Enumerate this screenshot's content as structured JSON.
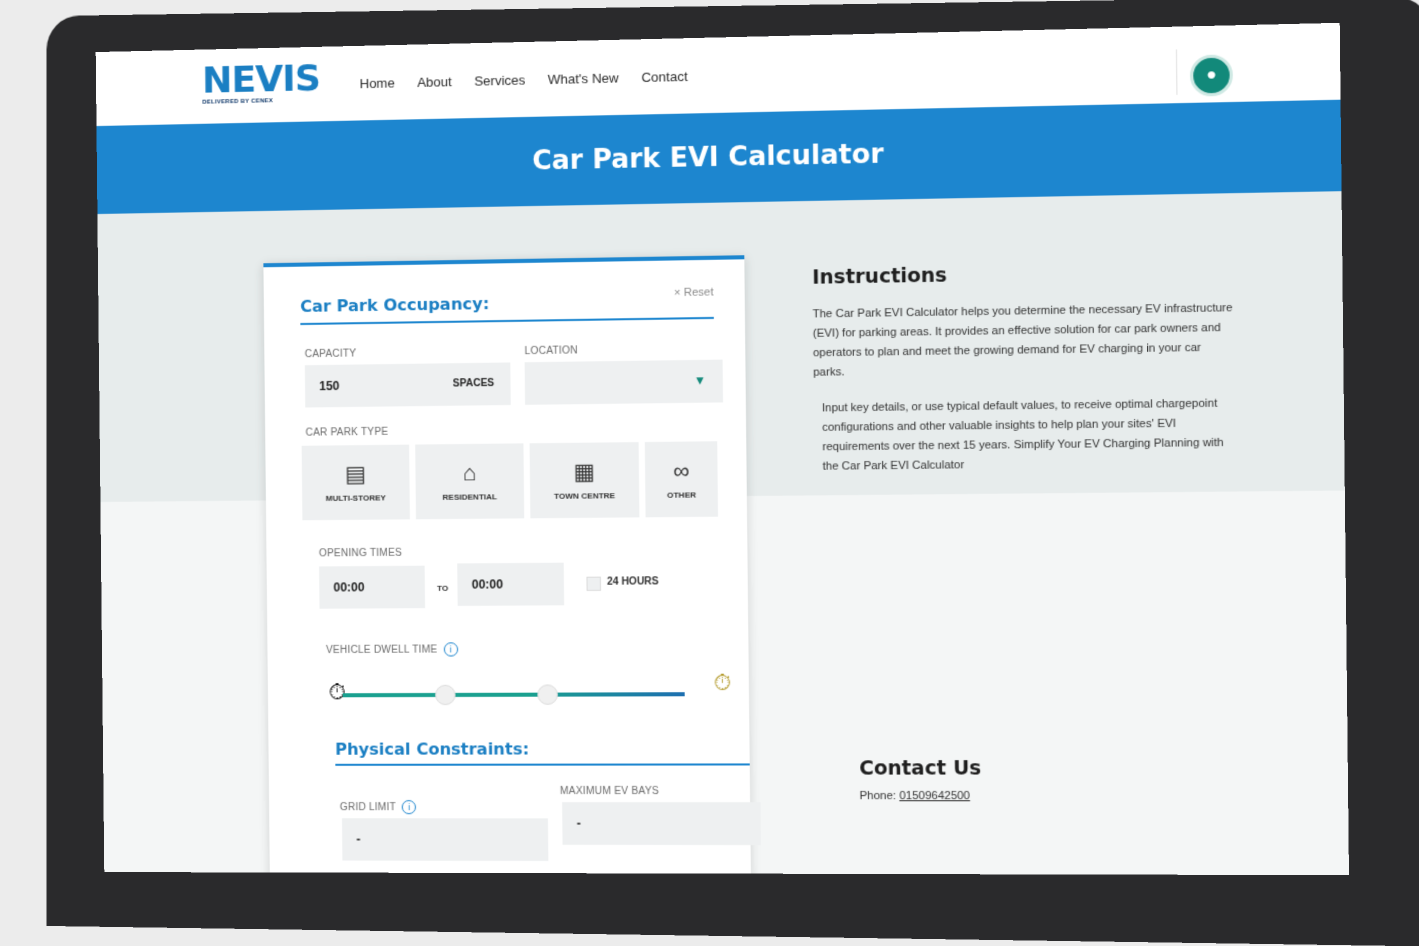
{
  "header": {
    "logo_word": "NEVIS",
    "logo_sub": "DELIVERED BY CENEX",
    "nav": [
      "Home",
      "About",
      "Services",
      "What's New",
      "Contact"
    ]
  },
  "banner": {
    "title": "Car Park EVI Calculator"
  },
  "occupancy": {
    "title": "Car Park Occupancy:",
    "reset_label": "× Reset",
    "capacity_label": "CAPACITY",
    "capacity_value": "150",
    "capacity_unit": "SPACES",
    "location_label": "LOCATION",
    "location_value": "",
    "car_park_type_label": "CAR PARK TYPE",
    "types": [
      {
        "label": "MULTI-STOREY",
        "icon": "multi-storey-icon"
      },
      {
        "label": "RESIDENTIAL",
        "icon": "house-car-icon"
      },
      {
        "label": "TOWN CENTRE",
        "icon": "town-centre-icon"
      },
      {
        "label": "OTHER",
        "icon": "infinity-icon"
      }
    ],
    "opening_times_label": "OPENING TIMES",
    "open_from": "00:00",
    "to_label": "TO",
    "open_to": "00:00",
    "hours24_label": "24 HOURS",
    "dwell_label": "VEHICLE DWELL TIME",
    "dwell_knobs": [
      0.3,
      0.6
    ]
  },
  "constraints": {
    "title": "Physical Constraints:",
    "grid_limit_label": "GRID LIMIT",
    "grid_limit_value": "-",
    "max_bays_label": "MAXIMUM EV BAYS",
    "max_bays_value": "-"
  },
  "instructions": {
    "title": "Instructions",
    "para1": "The Car Park EVI Calculator helps you determine the necessary EV infrastructure (EVI) for parking areas. It provides an effective solution for car park owners and operators to plan and meet the growing demand for EV charging in your car parks.",
    "para2": "Input key details, or use typical default values, to receive optimal chargepoint configurations and other valuable insights to help plan your sites' EVI requirements over the next 15 years. Simplify Your EV Charging Planning with the Car Park EVI Calculator"
  },
  "contact": {
    "title": "Contact Us",
    "phone_label": "Phone:",
    "phone": "01509642500"
  },
  "colors": {
    "brand_blue": "#1d86cf",
    "teal": "#12897a"
  }
}
